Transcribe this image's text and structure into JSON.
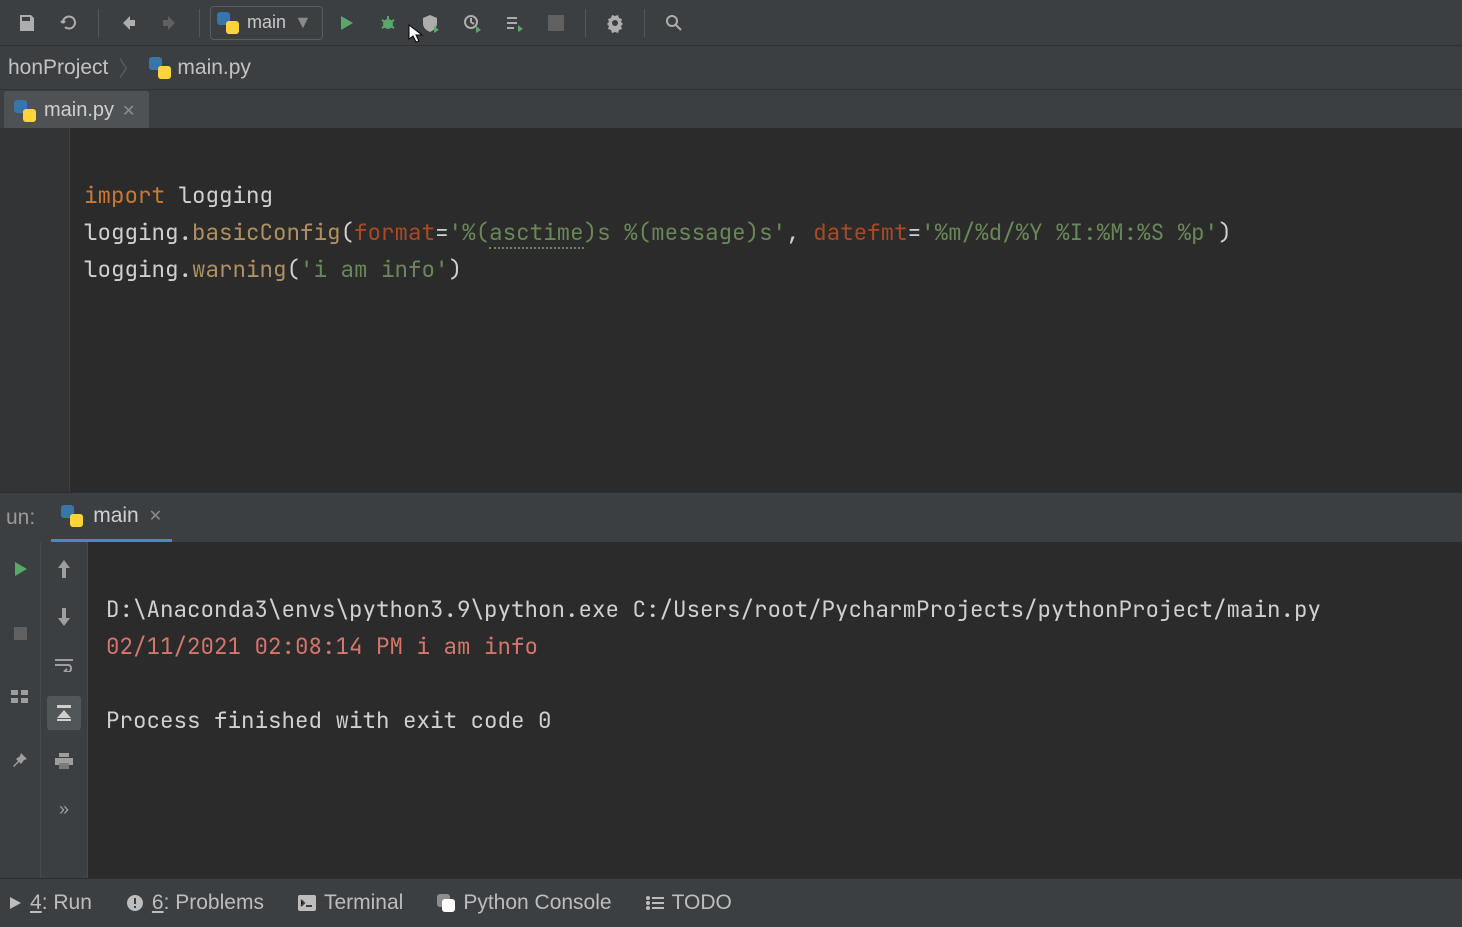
{
  "toolbar": {
    "run_config_label": "main"
  },
  "breadcrumb": {
    "project": "honProject",
    "file": "main.py"
  },
  "editor_tab": {
    "file": "main.py"
  },
  "code": {
    "line1": {
      "kw": "import",
      "rest": " logging"
    },
    "line2": {
      "a": "logging.",
      "func": "basicConfig",
      "open": "(",
      "k1": "format",
      "eq1": "=",
      "s1a": "'%(",
      "typo": "asctime",
      "s1b": ")s %(message)s'",
      "comma": ", ",
      "k2": "datefmt",
      "eq2": "=",
      "s2": "'%m/%d/%Y %I:%M:%S %p'",
      "close": ")"
    },
    "line3": {
      "a": "logging.",
      "func": "warning",
      "open": "(",
      "s": "'i am info'",
      "close": ")"
    }
  },
  "run": {
    "panel_label": "un:",
    "tab_label": "main"
  },
  "console": {
    "cmd": "D:\\Anaconda3\\envs\\python3.9\\python.exe C:/Users/root/PycharmProjects/pythonProject/main.py",
    "out": "02/11/2021 02:08:14 PM i am info",
    "blank": " ",
    "exit": "Process finished with exit code 0"
  },
  "bottom": {
    "run_digit": "4",
    "run_label": ": Run",
    "problems_digit": "6",
    "problems_label": ": Problems",
    "terminal": "Terminal",
    "pyconsole": "Python Console",
    "todo": "TODO"
  }
}
